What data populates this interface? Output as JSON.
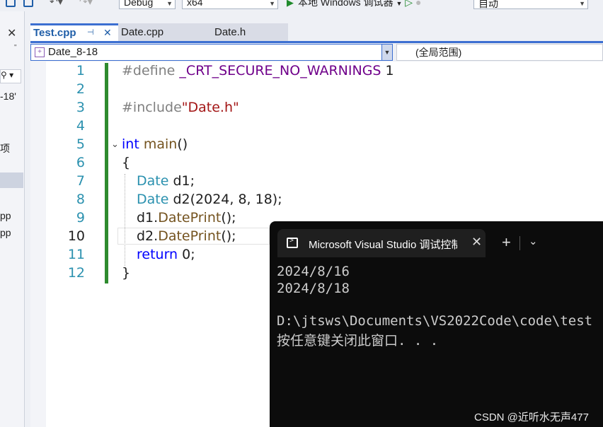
{
  "toolbar": {
    "config": "Debug",
    "platform": "x64",
    "run_label": "本地 Windows 调试器",
    "target": "自动"
  },
  "left_panel": {
    "fragment_1": "-18'",
    "fragment_2": "项",
    "fragment_3": "pp",
    "fragment_4": "pp"
  },
  "tabs": [
    {
      "label": "Test.cpp",
      "active": true
    },
    {
      "label": "Date.cpp",
      "active": false
    },
    {
      "label": "Date.h",
      "active": false
    }
  ],
  "nav": {
    "scope": "Date_8-18",
    "global": "(全局范围)"
  },
  "editor": {
    "current_line": 10,
    "lines": [
      {
        "n": "1"
      },
      {
        "n": "2"
      },
      {
        "n": "3"
      },
      {
        "n": "4"
      },
      {
        "n": "5"
      },
      {
        "n": "6"
      },
      {
        "n": "7"
      },
      {
        "n": "8"
      },
      {
        "n": "9"
      },
      {
        "n": "10"
      },
      {
        "n": "11"
      },
      {
        "n": "12"
      }
    ],
    "code": {
      "l1_kw": "#define",
      "l1_macro": "_CRT_SECURE_NO_WARNINGS",
      "l1_val": " 1",
      "l3_kw": "#include",
      "l3_str": "\"Date.h\"",
      "l5_type": "int",
      "l5_fn": "main",
      "l5_rest": "()",
      "l6": "{",
      "l7_type": "Date",
      "l7_rest": " d1;",
      "l8_type": "Date",
      "l8_rest": " d2(2024, 8, 18);",
      "l9_obj": "d1.",
      "l9_fn": "DatePrint",
      "l9_rest": "();",
      "l10_obj": "d2.",
      "l10_fn": "DatePrint",
      "l10_rest": "();",
      "l11_kw": "return",
      "l11_rest": " 0;",
      "l12": "}"
    }
  },
  "console": {
    "tab_title": "Microsoft Visual Studio 调试控制台",
    "output": [
      "2024/8/16",
      "2024/8/18",
      "",
      "D:\\jtsws\\Documents\\VS2022Code\\code\\test",
      "按任意键关闭此窗口. . ."
    ]
  },
  "watermark": "CSDN @近听水无声477",
  "colors": {
    "accent": "#3c6fd1",
    "keyword": "#0000ff",
    "macro": "#6f008a",
    "string": "#a31515",
    "type": "#2b91af",
    "function": "#74531f"
  }
}
